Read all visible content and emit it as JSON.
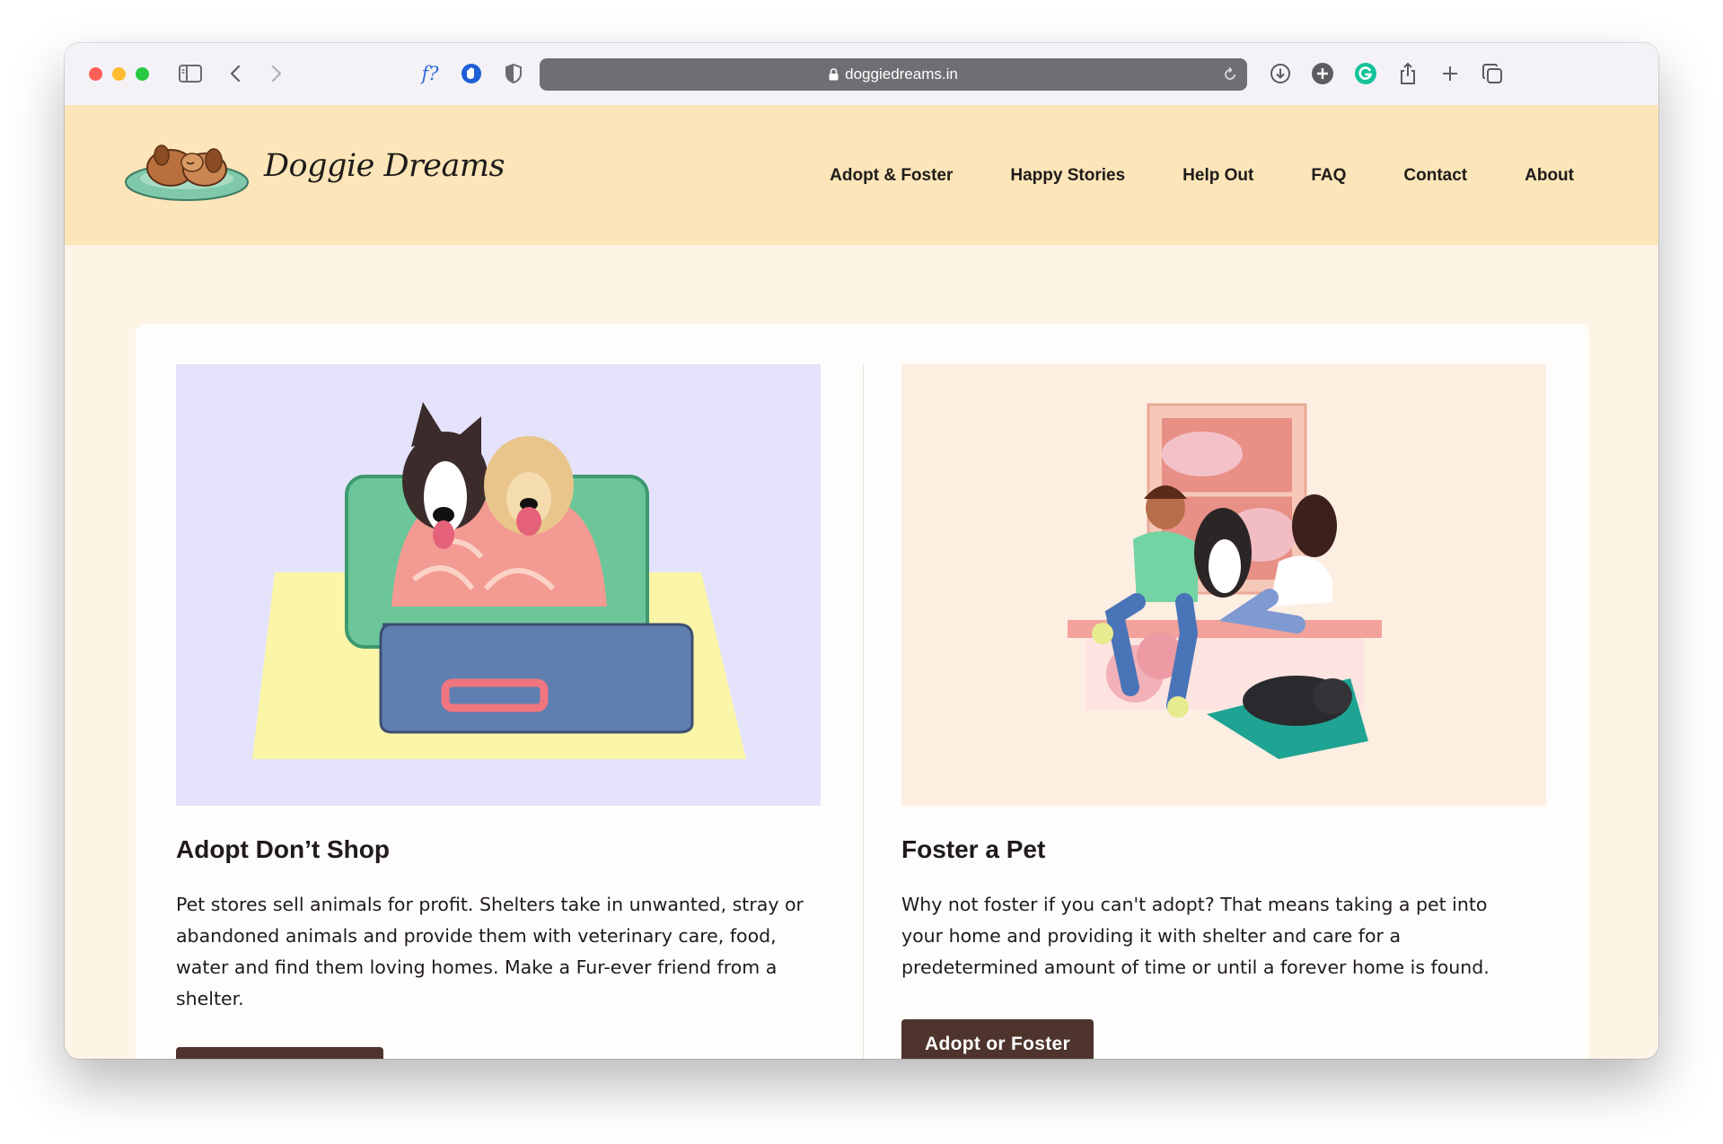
{
  "browser": {
    "url": "doggiedreams.in",
    "extension_label": "f?"
  },
  "site": {
    "logo_text": "Doggie Dreams",
    "nav": [
      "Adopt & Foster",
      "Happy Stories",
      "Help Out",
      "FAQ",
      "Contact",
      "About"
    ]
  },
  "cards": [
    {
      "title": "Adopt Don’t Shop",
      "body": "Pet stores sell animals for profit. Shelters take in unwanted, stray or abandoned animals and provide them with veterinary care, food, water and find them loving homes. Make a Fur-ever friend from a shelter.",
      "illustration_bg": "#e4e3fb"
    },
    {
      "title": "Foster a Pet",
      "body": "Why not foster if you can't adopt? That means taking a pet into your home and providing it with shelter and care for a predetermined amount of time or until a forever home is found.",
      "button": "Adopt or Foster",
      "illustration_bg": "#fdeee2"
    }
  ],
  "colors": {
    "header_bg": "#fce5b8",
    "page_bg": "#fdf4e6",
    "button_bg": "#4e342c"
  }
}
